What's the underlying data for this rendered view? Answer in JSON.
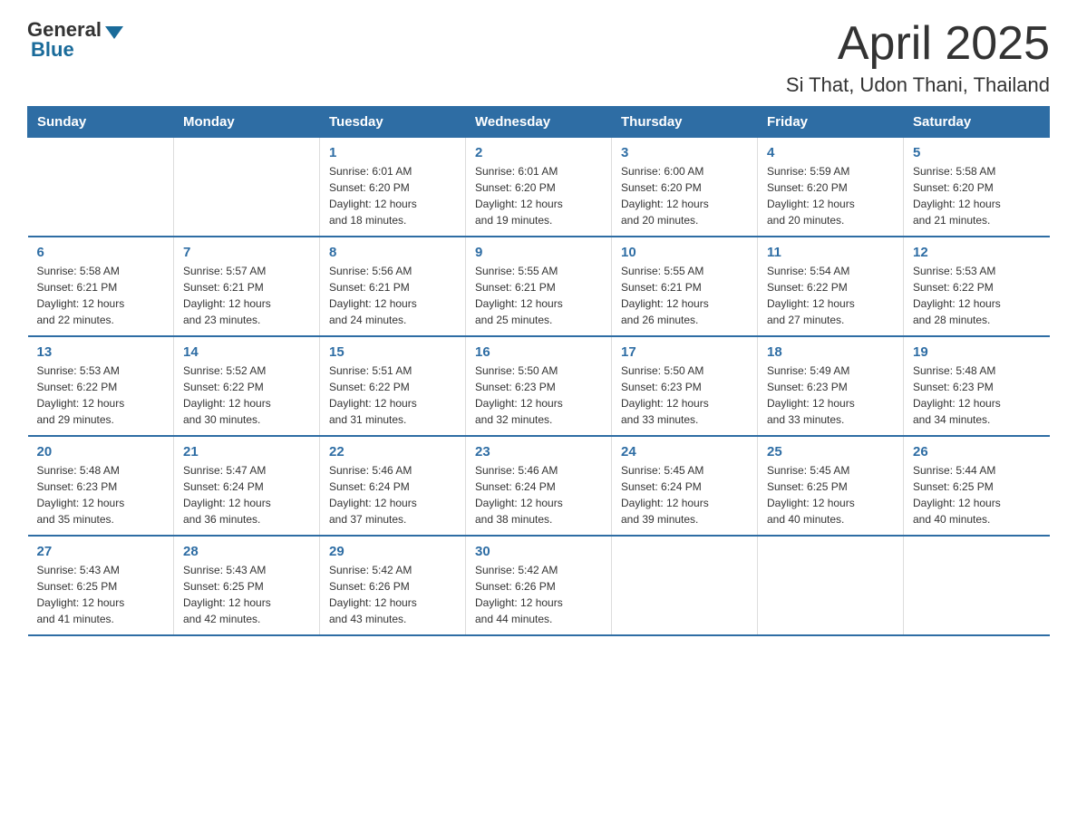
{
  "logo": {
    "general": "General",
    "blue": "Blue"
  },
  "header": {
    "month": "April 2025",
    "location": "Si That, Udon Thani, Thailand"
  },
  "weekdays": [
    "Sunday",
    "Monday",
    "Tuesday",
    "Wednesday",
    "Thursday",
    "Friday",
    "Saturday"
  ],
  "weeks": [
    [
      {
        "day": "",
        "info": ""
      },
      {
        "day": "",
        "info": ""
      },
      {
        "day": "1",
        "info": "Sunrise: 6:01 AM\nSunset: 6:20 PM\nDaylight: 12 hours\nand 18 minutes."
      },
      {
        "day": "2",
        "info": "Sunrise: 6:01 AM\nSunset: 6:20 PM\nDaylight: 12 hours\nand 19 minutes."
      },
      {
        "day": "3",
        "info": "Sunrise: 6:00 AM\nSunset: 6:20 PM\nDaylight: 12 hours\nand 20 minutes."
      },
      {
        "day": "4",
        "info": "Sunrise: 5:59 AM\nSunset: 6:20 PM\nDaylight: 12 hours\nand 20 minutes."
      },
      {
        "day": "5",
        "info": "Sunrise: 5:58 AM\nSunset: 6:20 PM\nDaylight: 12 hours\nand 21 minutes."
      }
    ],
    [
      {
        "day": "6",
        "info": "Sunrise: 5:58 AM\nSunset: 6:21 PM\nDaylight: 12 hours\nand 22 minutes."
      },
      {
        "day": "7",
        "info": "Sunrise: 5:57 AM\nSunset: 6:21 PM\nDaylight: 12 hours\nand 23 minutes."
      },
      {
        "day": "8",
        "info": "Sunrise: 5:56 AM\nSunset: 6:21 PM\nDaylight: 12 hours\nand 24 minutes."
      },
      {
        "day": "9",
        "info": "Sunrise: 5:55 AM\nSunset: 6:21 PM\nDaylight: 12 hours\nand 25 minutes."
      },
      {
        "day": "10",
        "info": "Sunrise: 5:55 AM\nSunset: 6:21 PM\nDaylight: 12 hours\nand 26 minutes."
      },
      {
        "day": "11",
        "info": "Sunrise: 5:54 AM\nSunset: 6:22 PM\nDaylight: 12 hours\nand 27 minutes."
      },
      {
        "day": "12",
        "info": "Sunrise: 5:53 AM\nSunset: 6:22 PM\nDaylight: 12 hours\nand 28 minutes."
      }
    ],
    [
      {
        "day": "13",
        "info": "Sunrise: 5:53 AM\nSunset: 6:22 PM\nDaylight: 12 hours\nand 29 minutes."
      },
      {
        "day": "14",
        "info": "Sunrise: 5:52 AM\nSunset: 6:22 PM\nDaylight: 12 hours\nand 30 minutes."
      },
      {
        "day": "15",
        "info": "Sunrise: 5:51 AM\nSunset: 6:22 PM\nDaylight: 12 hours\nand 31 minutes."
      },
      {
        "day": "16",
        "info": "Sunrise: 5:50 AM\nSunset: 6:23 PM\nDaylight: 12 hours\nand 32 minutes."
      },
      {
        "day": "17",
        "info": "Sunrise: 5:50 AM\nSunset: 6:23 PM\nDaylight: 12 hours\nand 33 minutes."
      },
      {
        "day": "18",
        "info": "Sunrise: 5:49 AM\nSunset: 6:23 PM\nDaylight: 12 hours\nand 33 minutes."
      },
      {
        "day": "19",
        "info": "Sunrise: 5:48 AM\nSunset: 6:23 PM\nDaylight: 12 hours\nand 34 minutes."
      }
    ],
    [
      {
        "day": "20",
        "info": "Sunrise: 5:48 AM\nSunset: 6:23 PM\nDaylight: 12 hours\nand 35 minutes."
      },
      {
        "day": "21",
        "info": "Sunrise: 5:47 AM\nSunset: 6:24 PM\nDaylight: 12 hours\nand 36 minutes."
      },
      {
        "day": "22",
        "info": "Sunrise: 5:46 AM\nSunset: 6:24 PM\nDaylight: 12 hours\nand 37 minutes."
      },
      {
        "day": "23",
        "info": "Sunrise: 5:46 AM\nSunset: 6:24 PM\nDaylight: 12 hours\nand 38 minutes."
      },
      {
        "day": "24",
        "info": "Sunrise: 5:45 AM\nSunset: 6:24 PM\nDaylight: 12 hours\nand 39 minutes."
      },
      {
        "day": "25",
        "info": "Sunrise: 5:45 AM\nSunset: 6:25 PM\nDaylight: 12 hours\nand 40 minutes."
      },
      {
        "day": "26",
        "info": "Sunrise: 5:44 AM\nSunset: 6:25 PM\nDaylight: 12 hours\nand 40 minutes."
      }
    ],
    [
      {
        "day": "27",
        "info": "Sunrise: 5:43 AM\nSunset: 6:25 PM\nDaylight: 12 hours\nand 41 minutes."
      },
      {
        "day": "28",
        "info": "Sunrise: 5:43 AM\nSunset: 6:25 PM\nDaylight: 12 hours\nand 42 minutes."
      },
      {
        "day": "29",
        "info": "Sunrise: 5:42 AM\nSunset: 6:26 PM\nDaylight: 12 hours\nand 43 minutes."
      },
      {
        "day": "30",
        "info": "Sunrise: 5:42 AM\nSunset: 6:26 PM\nDaylight: 12 hours\nand 44 minutes."
      },
      {
        "day": "",
        "info": ""
      },
      {
        "day": "",
        "info": ""
      },
      {
        "day": "",
        "info": ""
      }
    ]
  ]
}
